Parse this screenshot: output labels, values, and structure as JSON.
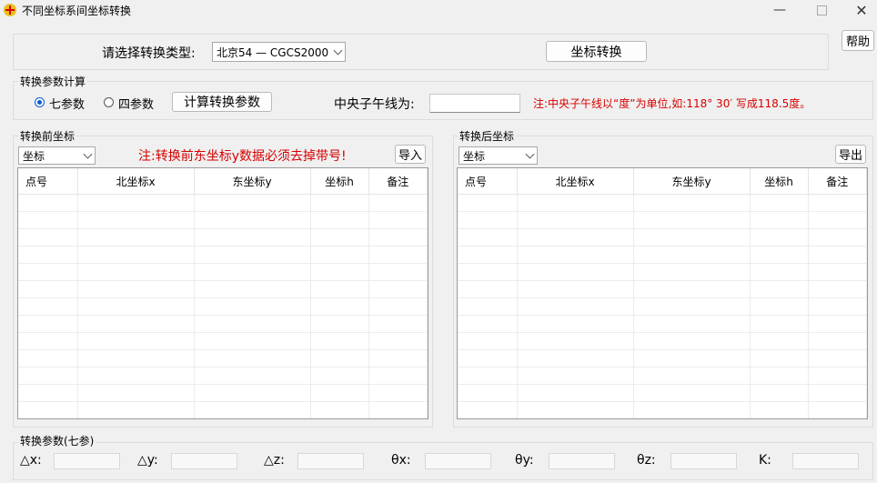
{
  "window": {
    "title": "不同坐标系间坐标转换",
    "minimize_icon": "minimize-icon",
    "maximize_icon": "maximize-icon",
    "close_icon": "close-icon"
  },
  "top": {
    "type_label": "请选择转换类型:",
    "type_value": "北京54 — CGCS2000",
    "convert_button": "坐标转换",
    "help_button": "帮助"
  },
  "params": {
    "group_label": "转换参数计算",
    "radio_seven": "七参数",
    "radio_four": "四参数",
    "selected": "七参数",
    "calc_button": "计算转换参数",
    "meridian_label": "中央子午线为:",
    "meridian_value": "",
    "note": "注:中央子午线以“度”为单位,如:118° 30′ 写成118.5度。"
  },
  "before": {
    "group_label": "转换前坐标",
    "select_value": "坐标",
    "note": "注:转换前东坐标y数据必须去掉带号!",
    "import_button": "导入",
    "columns": [
      "点号",
      "北坐标x",
      "东坐标y",
      "坐标h",
      "备注"
    ]
  },
  "after": {
    "group_label": "转换后坐标",
    "select_value": "坐标",
    "export_button": "导出",
    "columns": [
      "点号",
      "北坐标x",
      "东坐标y",
      "坐标h",
      "备注"
    ]
  },
  "seven_params": {
    "group_label": "转换参数(七参)",
    "labels": [
      "△x:",
      "△y:",
      "△z:",
      "θx:",
      "θy:",
      "θz:",
      "K:"
    ]
  }
}
